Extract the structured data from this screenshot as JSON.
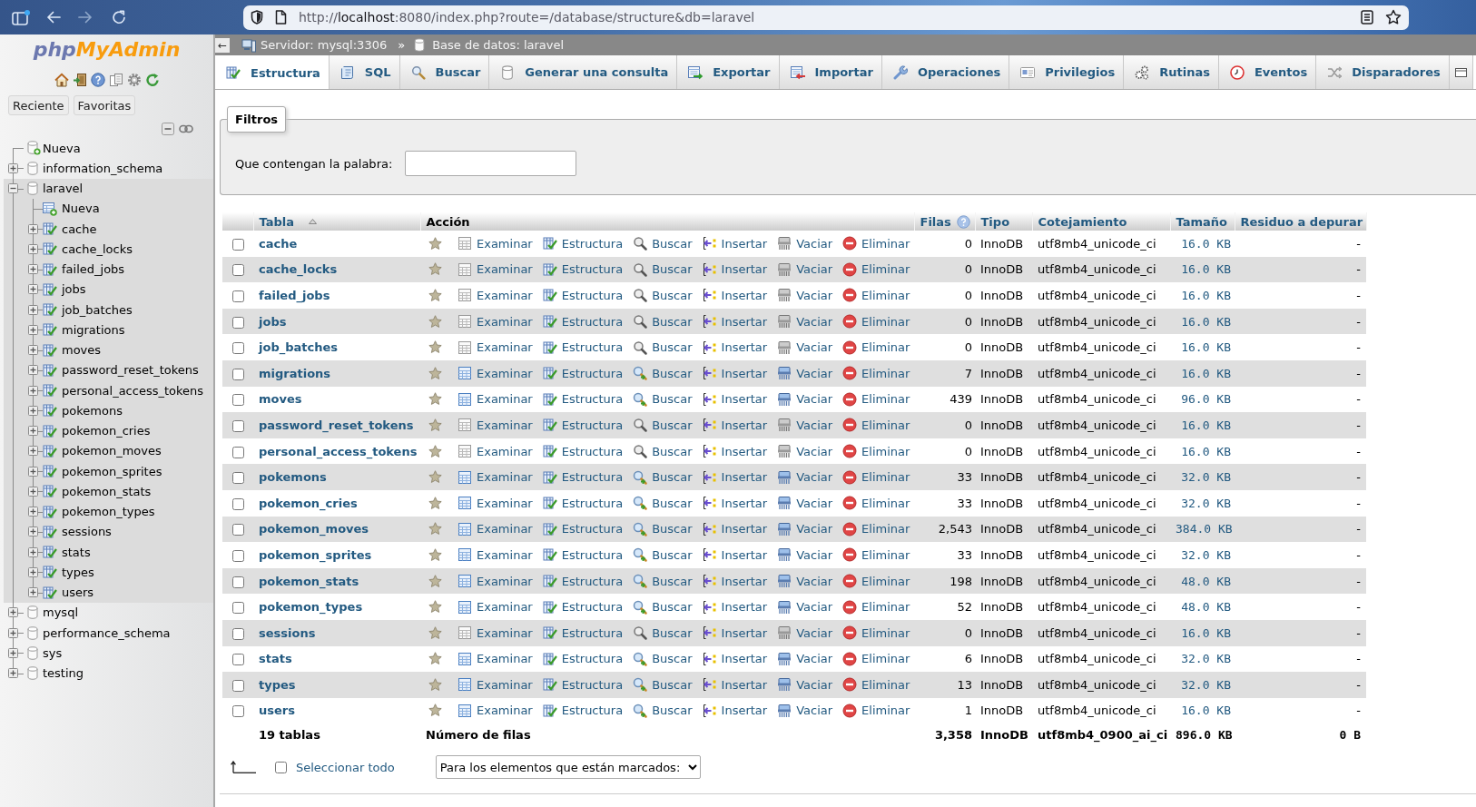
{
  "browser": {
    "url": {
      "scheme": "http://",
      "host": "localhost",
      "path": ":8080/index.php?route=/database/structure&db=laravel"
    }
  },
  "sidebar": {
    "logo": {
      "php": "php",
      "admin": "MyAdmin"
    },
    "buttons": [
      "Reciente",
      "Favoritas"
    ],
    "tree": [
      {
        "kind": "new",
        "label": "Nueva",
        "selected": false
      },
      {
        "kind": "database",
        "label": "information_schema",
        "expanded": false,
        "selected": false
      },
      {
        "kind": "database",
        "label": "laravel",
        "expanded": true,
        "selected": true,
        "children": [
          {
            "kind": "new",
            "label": "Nueva",
            "selected": false
          },
          {
            "kind": "table",
            "label": "cache",
            "expanded": false,
            "selected": false
          },
          {
            "kind": "table",
            "label": "cache_locks",
            "expanded": false,
            "selected": false
          },
          {
            "kind": "table",
            "label": "failed_jobs",
            "expanded": false,
            "selected": false
          },
          {
            "kind": "table",
            "label": "jobs",
            "expanded": false,
            "selected": false
          },
          {
            "kind": "table",
            "label": "job_batches",
            "expanded": false,
            "selected": false
          },
          {
            "kind": "table",
            "label": "migrations",
            "expanded": false,
            "selected": false
          },
          {
            "kind": "table",
            "label": "moves",
            "expanded": false,
            "selected": false
          },
          {
            "kind": "table",
            "label": "password_reset_tokens",
            "expanded": false,
            "selected": false
          },
          {
            "kind": "table",
            "label": "personal_access_tokens",
            "expanded": false,
            "selected": false
          },
          {
            "kind": "table",
            "label": "pokemons",
            "expanded": false,
            "selected": false
          },
          {
            "kind": "table",
            "label": "pokemon_cries",
            "expanded": false,
            "selected": false
          },
          {
            "kind": "table",
            "label": "pokemon_moves",
            "expanded": false,
            "selected": false
          },
          {
            "kind": "table",
            "label": "pokemon_sprites",
            "expanded": false,
            "selected": false
          },
          {
            "kind": "table",
            "label": "pokemon_stats",
            "expanded": false,
            "selected": false
          },
          {
            "kind": "table",
            "label": "pokemon_types",
            "expanded": false,
            "selected": false
          },
          {
            "kind": "table",
            "label": "sessions",
            "expanded": false,
            "selected": false
          },
          {
            "kind": "table",
            "label": "stats",
            "expanded": false,
            "selected": false
          },
          {
            "kind": "table",
            "label": "types",
            "expanded": false,
            "selected": false
          },
          {
            "kind": "table",
            "label": "users",
            "expanded": false,
            "selected": false
          }
        ]
      },
      {
        "kind": "database",
        "label": "mysql",
        "expanded": false,
        "selected": false
      },
      {
        "kind": "database",
        "label": "performance_schema",
        "expanded": false,
        "selected": false
      },
      {
        "kind": "database",
        "label": "sys",
        "expanded": false,
        "selected": false
      },
      {
        "kind": "database",
        "label": "testing",
        "expanded": false,
        "selected": false
      }
    ]
  },
  "breadcrumb": {
    "collapse": "←",
    "server": "Servidor: mysql:3306",
    "separator": "»",
    "database": "Base de datos: laravel"
  },
  "tabs": [
    {
      "label": "Estructura",
      "selected": true
    },
    {
      "label": "SQL",
      "selected": false
    },
    {
      "label": "Buscar",
      "selected": false
    },
    {
      "label": "Generar una consulta",
      "selected": false
    },
    {
      "label": "Exportar",
      "selected": false
    },
    {
      "label": "Importar",
      "selected": false
    },
    {
      "label": "Operaciones",
      "selected": false
    },
    {
      "label": "Privilegios",
      "selected": false
    },
    {
      "label": "Rutinas",
      "selected": false
    },
    {
      "label": "Eventos",
      "selected": false
    },
    {
      "label": "Disparadores",
      "selected": false
    }
  ],
  "filters": {
    "legend": "Filtros",
    "label": "Que contengan la palabra:"
  },
  "table": {
    "columns": [
      {
        "label": "Tabla",
        "sortable": true,
        "sorted": true,
        "help": false
      },
      {
        "label": "Acción",
        "sortable": false,
        "sorted": false,
        "help": false
      },
      {
        "label": "Filas",
        "sortable": true,
        "sorted": false,
        "help": true
      },
      {
        "label": "Tipo",
        "sortable": true,
        "sorted": false,
        "help": false
      },
      {
        "label": "Cotejamiento",
        "sortable": true,
        "sorted": false,
        "help": false
      },
      {
        "label": "Tamaño",
        "sortable": true,
        "sorted": false,
        "help": false
      },
      {
        "label": "Residuo a depurar",
        "sortable": true,
        "sorted": false,
        "help": false
      }
    ],
    "rows": [
      {
        "name": "cache",
        "checked": false,
        "favorite": false,
        "empty": true,
        "actions": [
          "Examinar",
          "Estructura",
          "Buscar",
          "Insertar",
          "Vaciar",
          "Eliminar"
        ],
        "rows": "0",
        "type": "InnoDB",
        "collation": "utf8mb4_unicode_ci",
        "size": "16.0 KB",
        "overhead": "-"
      },
      {
        "name": "cache_locks",
        "checked": false,
        "favorite": false,
        "empty": true,
        "actions": [
          "Examinar",
          "Estructura",
          "Buscar",
          "Insertar",
          "Vaciar",
          "Eliminar"
        ],
        "rows": "0",
        "type": "InnoDB",
        "collation": "utf8mb4_unicode_ci",
        "size": "16.0 KB",
        "overhead": "-"
      },
      {
        "name": "failed_jobs",
        "checked": false,
        "favorite": false,
        "empty": true,
        "actions": [
          "Examinar",
          "Estructura",
          "Buscar",
          "Insertar",
          "Vaciar",
          "Eliminar"
        ],
        "rows": "0",
        "type": "InnoDB",
        "collation": "utf8mb4_unicode_ci",
        "size": "16.0 KB",
        "overhead": "-"
      },
      {
        "name": "jobs",
        "checked": false,
        "favorite": false,
        "empty": true,
        "actions": [
          "Examinar",
          "Estructura",
          "Buscar",
          "Insertar",
          "Vaciar",
          "Eliminar"
        ],
        "rows": "0",
        "type": "InnoDB",
        "collation": "utf8mb4_unicode_ci",
        "size": "16.0 KB",
        "overhead": "-"
      },
      {
        "name": "job_batches",
        "checked": false,
        "favorite": false,
        "empty": true,
        "actions": [
          "Examinar",
          "Estructura",
          "Buscar",
          "Insertar",
          "Vaciar",
          "Eliminar"
        ],
        "rows": "0",
        "type": "InnoDB",
        "collation": "utf8mb4_unicode_ci",
        "size": "16.0 KB",
        "overhead": "-"
      },
      {
        "name": "migrations",
        "checked": false,
        "favorite": false,
        "empty": false,
        "actions": [
          "Examinar",
          "Estructura",
          "Buscar",
          "Insertar",
          "Vaciar",
          "Eliminar"
        ],
        "rows": "7",
        "type": "InnoDB",
        "collation": "utf8mb4_unicode_ci",
        "size": "16.0 KB",
        "overhead": "-"
      },
      {
        "name": "moves",
        "checked": false,
        "favorite": false,
        "empty": false,
        "actions": [
          "Examinar",
          "Estructura",
          "Buscar",
          "Insertar",
          "Vaciar",
          "Eliminar"
        ],
        "rows": "439",
        "type": "InnoDB",
        "collation": "utf8mb4_unicode_ci",
        "size": "96.0 KB",
        "overhead": "-"
      },
      {
        "name": "password_reset_tokens",
        "checked": false,
        "favorite": false,
        "empty": true,
        "actions": [
          "Examinar",
          "Estructura",
          "Buscar",
          "Insertar",
          "Vaciar",
          "Eliminar"
        ],
        "rows": "0",
        "type": "InnoDB",
        "collation": "utf8mb4_unicode_ci",
        "size": "16.0 KB",
        "overhead": "-"
      },
      {
        "name": "personal_access_tokens",
        "checked": false,
        "favorite": false,
        "empty": true,
        "actions": [
          "Examinar",
          "Estructura",
          "Buscar",
          "Insertar",
          "Vaciar",
          "Eliminar"
        ],
        "rows": "0",
        "type": "InnoDB",
        "collation": "utf8mb4_unicode_ci",
        "size": "16.0 KB",
        "overhead": "-"
      },
      {
        "name": "pokemons",
        "checked": false,
        "favorite": false,
        "empty": false,
        "actions": [
          "Examinar",
          "Estructura",
          "Buscar",
          "Insertar",
          "Vaciar",
          "Eliminar"
        ],
        "rows": "33",
        "type": "InnoDB",
        "collation": "utf8mb4_unicode_ci",
        "size": "32.0 KB",
        "overhead": "-"
      },
      {
        "name": "pokemon_cries",
        "checked": false,
        "favorite": false,
        "empty": false,
        "actions": [
          "Examinar",
          "Estructura",
          "Buscar",
          "Insertar",
          "Vaciar",
          "Eliminar"
        ],
        "rows": "33",
        "type": "InnoDB",
        "collation": "utf8mb4_unicode_ci",
        "size": "32.0 KB",
        "overhead": "-"
      },
      {
        "name": "pokemon_moves",
        "checked": false,
        "favorite": false,
        "empty": false,
        "actions": [
          "Examinar",
          "Estructura",
          "Buscar",
          "Insertar",
          "Vaciar",
          "Eliminar"
        ],
        "rows": "2,543",
        "type": "InnoDB",
        "collation": "utf8mb4_unicode_ci",
        "size": "384.0 KB",
        "overhead": "-"
      },
      {
        "name": "pokemon_sprites",
        "checked": false,
        "favorite": false,
        "empty": false,
        "actions": [
          "Examinar",
          "Estructura",
          "Buscar",
          "Insertar",
          "Vaciar",
          "Eliminar"
        ],
        "rows": "33",
        "type": "InnoDB",
        "collation": "utf8mb4_unicode_ci",
        "size": "32.0 KB",
        "overhead": "-"
      },
      {
        "name": "pokemon_stats",
        "checked": false,
        "favorite": false,
        "empty": false,
        "actions": [
          "Examinar",
          "Estructura",
          "Buscar",
          "Insertar",
          "Vaciar",
          "Eliminar"
        ],
        "rows": "198",
        "type": "InnoDB",
        "collation": "utf8mb4_unicode_ci",
        "size": "48.0 KB",
        "overhead": "-"
      },
      {
        "name": "pokemon_types",
        "checked": false,
        "favorite": false,
        "empty": false,
        "actions": [
          "Examinar",
          "Estructura",
          "Buscar",
          "Insertar",
          "Vaciar",
          "Eliminar"
        ],
        "rows": "52",
        "type": "InnoDB",
        "collation": "utf8mb4_unicode_ci",
        "size": "48.0 KB",
        "overhead": "-"
      },
      {
        "name": "sessions",
        "checked": false,
        "favorite": false,
        "empty": true,
        "actions": [
          "Examinar",
          "Estructura",
          "Buscar",
          "Insertar",
          "Vaciar",
          "Eliminar"
        ],
        "rows": "0",
        "type": "InnoDB",
        "collation": "utf8mb4_unicode_ci",
        "size": "16.0 KB",
        "overhead": "-"
      },
      {
        "name": "stats",
        "checked": false,
        "favorite": false,
        "empty": false,
        "actions": [
          "Examinar",
          "Estructura",
          "Buscar",
          "Insertar",
          "Vaciar",
          "Eliminar"
        ],
        "rows": "6",
        "type": "InnoDB",
        "collation": "utf8mb4_unicode_ci",
        "size": "32.0 KB",
        "overhead": "-"
      },
      {
        "name": "types",
        "checked": false,
        "favorite": false,
        "empty": false,
        "actions": [
          "Examinar",
          "Estructura",
          "Buscar",
          "Insertar",
          "Vaciar",
          "Eliminar"
        ],
        "rows": "13",
        "type": "InnoDB",
        "collation": "utf8mb4_unicode_ci",
        "size": "32.0 KB",
        "overhead": "-"
      },
      {
        "name": "users",
        "checked": false,
        "favorite": false,
        "empty": false,
        "actions": [
          "Examinar",
          "Estructura",
          "Buscar",
          "Insertar",
          "Vaciar",
          "Eliminar"
        ],
        "rows": "1",
        "type": "InnoDB",
        "collation": "utf8mb4_unicode_ci",
        "size": "16.0 KB",
        "overhead": "-"
      }
    ],
    "summary": {
      "label": "19 tablas",
      "action_label": "Número de filas",
      "rows": "3,358",
      "type": "InnoDB",
      "collation": "utf8mb4_0900_ai_ci",
      "size": "896.0 KB",
      "overhead": "0 B"
    }
  },
  "footer": {
    "select_all": {
      "label": "Seleccionar todo",
      "checked": false
    },
    "bulk_action": "Para los elementos que están marcados:"
  }
}
